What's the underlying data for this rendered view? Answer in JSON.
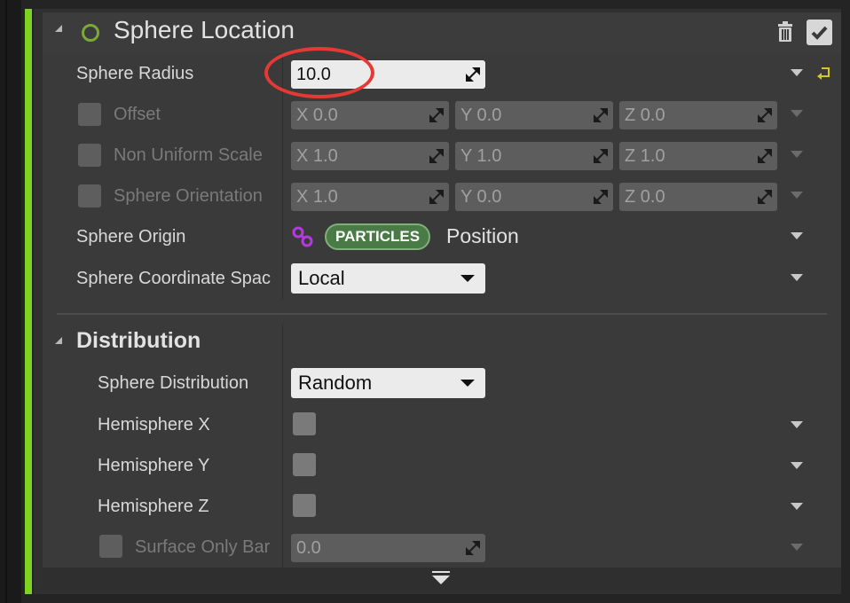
{
  "module": {
    "title": "Sphere Location",
    "sphere_radius": {
      "label": "Sphere Radius",
      "value": "10.0"
    },
    "offset": {
      "label": "Offset",
      "x": "X 0.0",
      "y": "Y 0.0",
      "z": "Z 0.0"
    },
    "non_uniform_scale": {
      "label": "Non Uniform Scale",
      "x": "X 1.0",
      "y": "Y 1.0",
      "z": "Z 1.0"
    },
    "sphere_orientation": {
      "label": "Sphere Orientation",
      "x": "X 1.0",
      "y": "Y 0.0",
      "z": "Z 0.0"
    },
    "sphere_origin": {
      "label": "Sphere Origin",
      "tag": "PARTICLES",
      "value": "Position"
    },
    "coordinate_space": {
      "label": "Sphere Coordinate Spac",
      "value": "Local"
    }
  },
  "distribution": {
    "title": "Distribution",
    "sphere_distribution": {
      "label": "Sphere Distribution",
      "value": "Random"
    },
    "hemisphere_x": {
      "label": "Hemisphere X"
    },
    "hemisphere_y": {
      "label": "Hemisphere Y"
    },
    "hemisphere_z": {
      "label": "Hemisphere Z"
    },
    "surface_only_band": {
      "label": "Surface Only Bar",
      "value": "0.0"
    }
  },
  "colors": {
    "accent_green": "#7ed321",
    "annotation_red": "#e53935",
    "link_purple": "#b43be0",
    "particles_tag": "#4a7a45"
  }
}
